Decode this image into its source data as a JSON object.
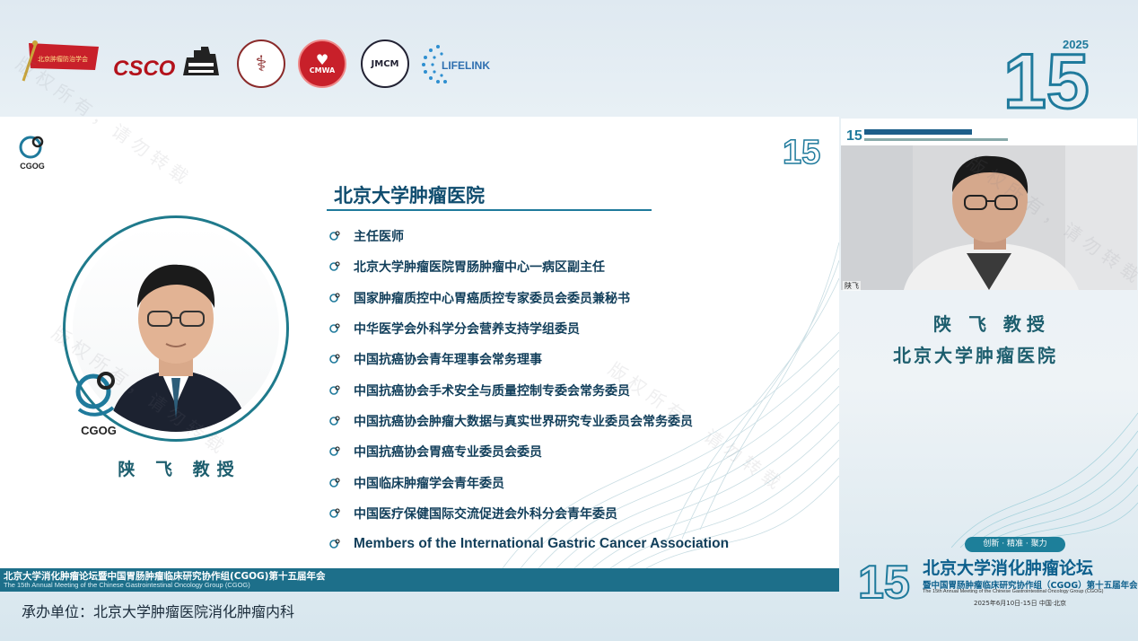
{
  "logos": {
    "flag_text": "北京肿瘤防治学会",
    "csco_text": "CSCO",
    "round1": "⚕",
    "round2": "CMWA",
    "round3": "JMCM",
    "lifelink": "LIFELINK",
    "year": "2025",
    "big_number": "15"
  },
  "slide": {
    "corner_logo_text": "CGOG",
    "corner_number": "15",
    "badge_text": "CGOG",
    "speaker_name": "陕 飞 教授",
    "hospital_title": "北京大学肿瘤医院",
    "credentials": [
      "主任医师",
      "北京大学肿瘤医院胃肠肿瘤中心一病区副主任",
      "国家肿瘤质控中心胃癌质控专家委员会委员兼秘书",
      "中华医学会外科学分会营养支持学组委员",
      "中国抗癌协会青年理事会常务理事",
      "中国抗癌协会手术安全与质量控制专委会常务委员",
      "中国抗癌协会肿瘤大数据与真实世界研究专业委员会常务委员",
      "中国抗癌协会胃癌专业委员会委员",
      "中国临床肿瘤学会青年委员",
      "中国医疗保健国际交流促进会外科分会青年委员",
      "Members of the International Gastric Cancer Association"
    ],
    "footer_zh": "北京大学消化肿瘤论坛暨中国胃肠肿瘤临床研究协作组(CGOG)第十五届年会",
    "footer_en": "The 15th Annual Meeting of the Chinese Gastrointestinal Oncology Group (CGOG)"
  },
  "video": {
    "label": "陕飞",
    "name": "陕 飞 教授",
    "hospital": "北京大学肿瘤医院"
  },
  "conference": {
    "tags": "创新 · 精准 · 聚力",
    "number": "15",
    "title": "北京大学消化肿瘤论坛",
    "subtitle": "暨中国胃肠肿瘤临床研究协作组（CGOG）第十五届年会",
    "english": "The 15th Annual Meeting of the Chinese Gastrointestinal Oncology Group (CGOG)",
    "date": "2025年6月10日-15日   中国·北京"
  },
  "organizer": "承办单位：北京大学肿瘤医院消化肿瘤内科",
  "watermark": "版权所有，请勿转载",
  "colors": {
    "teal": "#1f7a8c",
    "navy_text": "#113e5a",
    "title_blue": "#0f4c6e",
    "footer_bar": "#1d6f8a"
  }
}
